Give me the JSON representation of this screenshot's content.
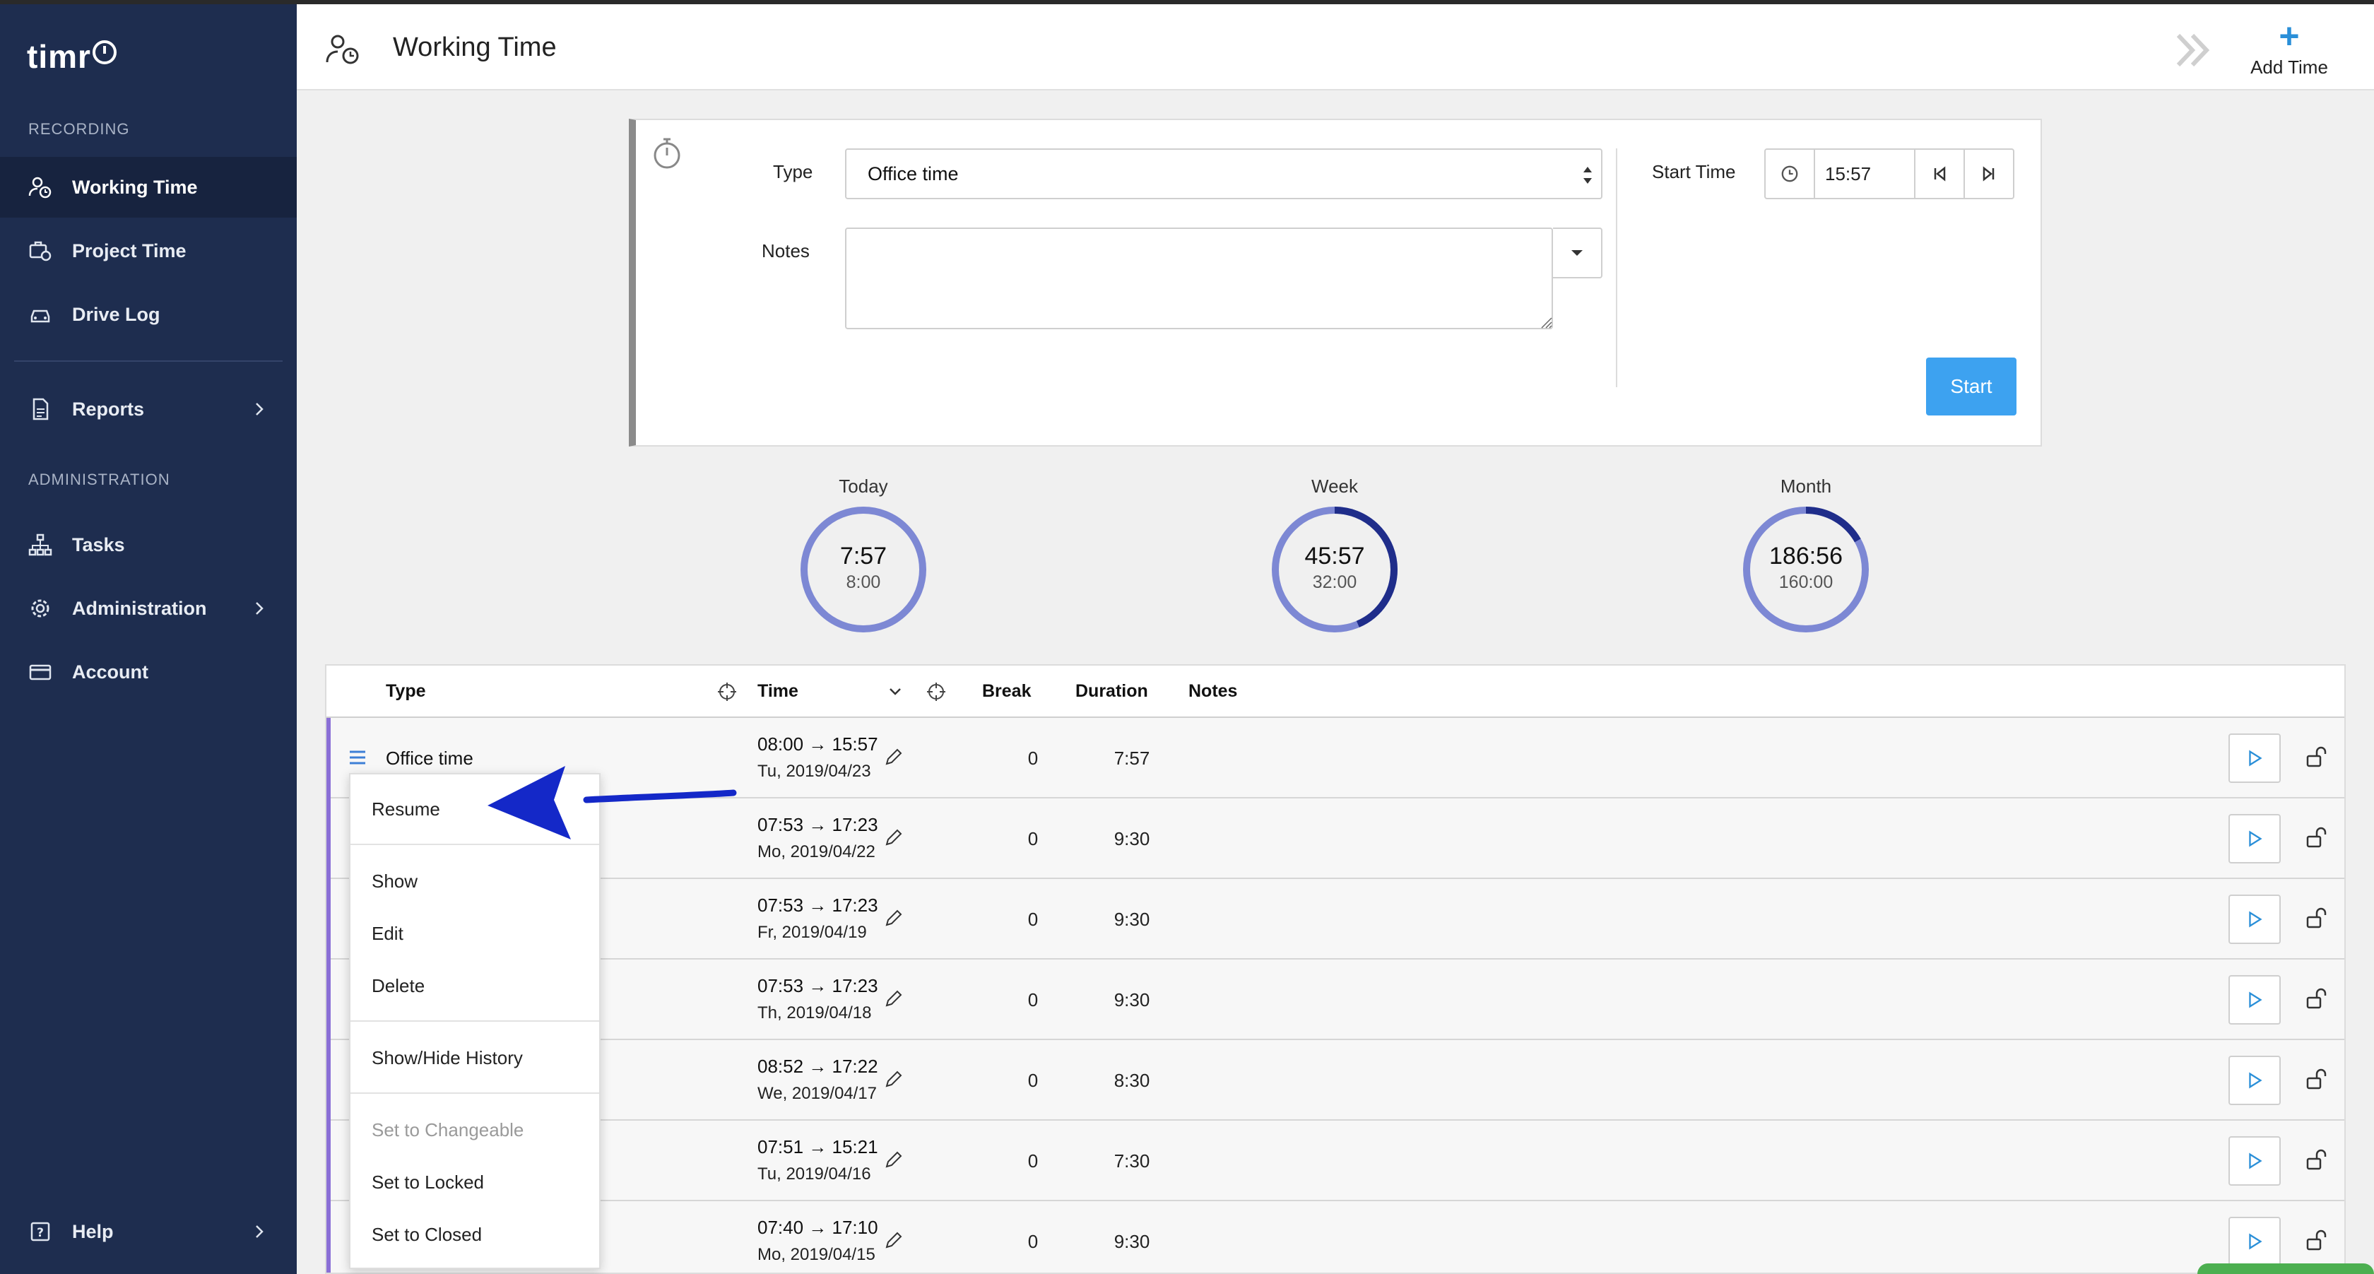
{
  "app": {
    "logo": "timr",
    "colors": {
      "sidebar": "#1e2d4f",
      "accent": "#3da2f0",
      "row_bar": "#8a6fd6",
      "gauge_light": "#7d88d4",
      "gauge_dark": "#1f2d8a"
    }
  },
  "sidebar": {
    "section_recording": "RECORDING",
    "working_time": "Working Time",
    "project_time": "Project Time",
    "drive_log": "Drive Log",
    "reports": "Reports",
    "section_administration": "ADMINISTRATION",
    "tasks": "Tasks",
    "administration": "Administration",
    "account": "Account",
    "help": "Help"
  },
  "header": {
    "title": "Working Time",
    "add_time": "Add Time"
  },
  "timer": {
    "type_label": "Type",
    "type_value": "Office time",
    "notes_label": "Notes",
    "notes_value": "",
    "start_time_label": "Start Time",
    "start_time_value": "15:57",
    "start_button": "Start"
  },
  "summary": [
    {
      "label": "Today",
      "value": "7:57",
      "target": "8:00",
      "progress": 0.994
    },
    {
      "label": "Week",
      "value": "45:57",
      "target": "32:00",
      "progress": 1.436
    },
    {
      "label": "Month",
      "value": "186:56",
      "target": "160:00",
      "progress": 1.168
    }
  ],
  "table": {
    "headers": {
      "type": "Type",
      "time": "Time",
      "break": "Break",
      "duration": "Duration",
      "notes": "Notes"
    },
    "rows": [
      {
        "type": "Office time",
        "time": "08:00 → 15:57",
        "date": "Tu, 2019/04/23",
        "break": "0",
        "duration": "7:57"
      },
      {
        "type": "",
        "time": "07:53 → 17:23",
        "date": "Mo, 2019/04/22",
        "break": "0",
        "duration": "9:30"
      },
      {
        "type": "",
        "time": "07:53 → 17:23",
        "date": "Fr, 2019/04/19",
        "break": "0",
        "duration": "9:30"
      },
      {
        "type": "",
        "time": "07:53 → 17:23",
        "date": "Th, 2019/04/18",
        "break": "0",
        "duration": "9:30"
      },
      {
        "type": "",
        "time": "08:52 → 17:22",
        "date": "We, 2019/04/17",
        "break": "0",
        "duration": "8:30"
      },
      {
        "type": "",
        "time": "07:51 → 15:21",
        "date": "Tu, 2019/04/16",
        "break": "0",
        "duration": "7:30"
      },
      {
        "type": "",
        "time": "07:40 → 17:10",
        "date": "Mo, 2019/04/15",
        "break": "0",
        "duration": "9:30"
      }
    ]
  },
  "context_menu": {
    "resume": "Resume",
    "show": "Show",
    "edit": "Edit",
    "delete": "Delete",
    "show_hide_history": "Show/Hide History",
    "set_to_changeable": "Set to Changeable",
    "set_to_locked": "Set to Locked",
    "set_to_closed": "Set to Closed"
  },
  "icons": {
    "header": [
      "user-clock-icon",
      "double-chevron-right-icon",
      "plus-icon"
    ],
    "timer": [
      "stopwatch-icon",
      "select-updown-icon",
      "caret-down-icon",
      "clock-icon",
      "skip-back-icon",
      "skip-forward-icon"
    ],
    "table": [
      "crosshair-icon",
      "chevron-down-icon",
      "menu-icon",
      "pencil-icon",
      "play-icon",
      "unlock-icon"
    ]
  }
}
